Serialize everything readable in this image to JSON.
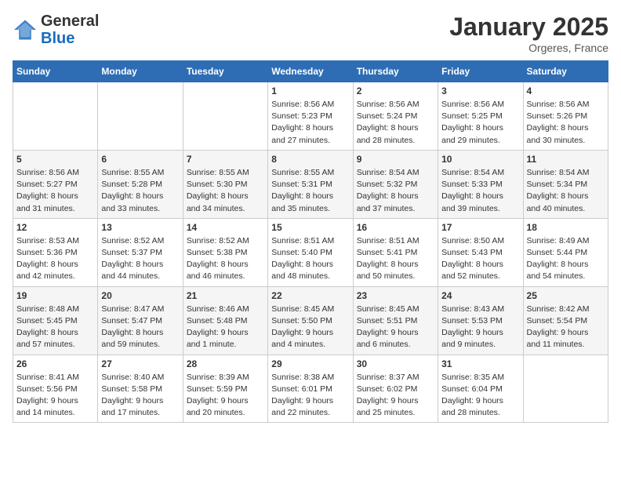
{
  "header": {
    "logo_general": "General",
    "logo_blue": "Blue",
    "month": "January 2025",
    "location": "Orgeres, France"
  },
  "weekdays": [
    "Sunday",
    "Monday",
    "Tuesday",
    "Wednesday",
    "Thursday",
    "Friday",
    "Saturday"
  ],
  "weeks": [
    [
      {
        "day": "",
        "content": ""
      },
      {
        "day": "",
        "content": ""
      },
      {
        "day": "",
        "content": ""
      },
      {
        "day": "1",
        "content": "Sunrise: 8:56 AM\nSunset: 5:23 PM\nDaylight: 8 hours\nand 27 minutes."
      },
      {
        "day": "2",
        "content": "Sunrise: 8:56 AM\nSunset: 5:24 PM\nDaylight: 8 hours\nand 28 minutes."
      },
      {
        "day": "3",
        "content": "Sunrise: 8:56 AM\nSunset: 5:25 PM\nDaylight: 8 hours\nand 29 minutes."
      },
      {
        "day": "4",
        "content": "Sunrise: 8:56 AM\nSunset: 5:26 PM\nDaylight: 8 hours\nand 30 minutes."
      }
    ],
    [
      {
        "day": "5",
        "content": "Sunrise: 8:56 AM\nSunset: 5:27 PM\nDaylight: 8 hours\nand 31 minutes."
      },
      {
        "day": "6",
        "content": "Sunrise: 8:55 AM\nSunset: 5:28 PM\nDaylight: 8 hours\nand 33 minutes."
      },
      {
        "day": "7",
        "content": "Sunrise: 8:55 AM\nSunset: 5:30 PM\nDaylight: 8 hours\nand 34 minutes."
      },
      {
        "day": "8",
        "content": "Sunrise: 8:55 AM\nSunset: 5:31 PM\nDaylight: 8 hours\nand 35 minutes."
      },
      {
        "day": "9",
        "content": "Sunrise: 8:54 AM\nSunset: 5:32 PM\nDaylight: 8 hours\nand 37 minutes."
      },
      {
        "day": "10",
        "content": "Sunrise: 8:54 AM\nSunset: 5:33 PM\nDaylight: 8 hours\nand 39 minutes."
      },
      {
        "day": "11",
        "content": "Sunrise: 8:54 AM\nSunset: 5:34 PM\nDaylight: 8 hours\nand 40 minutes."
      }
    ],
    [
      {
        "day": "12",
        "content": "Sunrise: 8:53 AM\nSunset: 5:36 PM\nDaylight: 8 hours\nand 42 minutes."
      },
      {
        "day": "13",
        "content": "Sunrise: 8:52 AM\nSunset: 5:37 PM\nDaylight: 8 hours\nand 44 minutes."
      },
      {
        "day": "14",
        "content": "Sunrise: 8:52 AM\nSunset: 5:38 PM\nDaylight: 8 hours\nand 46 minutes."
      },
      {
        "day": "15",
        "content": "Sunrise: 8:51 AM\nSunset: 5:40 PM\nDaylight: 8 hours\nand 48 minutes."
      },
      {
        "day": "16",
        "content": "Sunrise: 8:51 AM\nSunset: 5:41 PM\nDaylight: 8 hours\nand 50 minutes."
      },
      {
        "day": "17",
        "content": "Sunrise: 8:50 AM\nSunset: 5:43 PM\nDaylight: 8 hours\nand 52 minutes."
      },
      {
        "day": "18",
        "content": "Sunrise: 8:49 AM\nSunset: 5:44 PM\nDaylight: 8 hours\nand 54 minutes."
      }
    ],
    [
      {
        "day": "19",
        "content": "Sunrise: 8:48 AM\nSunset: 5:45 PM\nDaylight: 8 hours\nand 57 minutes."
      },
      {
        "day": "20",
        "content": "Sunrise: 8:47 AM\nSunset: 5:47 PM\nDaylight: 8 hours\nand 59 minutes."
      },
      {
        "day": "21",
        "content": "Sunrise: 8:46 AM\nSunset: 5:48 PM\nDaylight: 9 hours\nand 1 minute."
      },
      {
        "day": "22",
        "content": "Sunrise: 8:45 AM\nSunset: 5:50 PM\nDaylight: 9 hours\nand 4 minutes."
      },
      {
        "day": "23",
        "content": "Sunrise: 8:45 AM\nSunset: 5:51 PM\nDaylight: 9 hours\nand 6 minutes."
      },
      {
        "day": "24",
        "content": "Sunrise: 8:43 AM\nSunset: 5:53 PM\nDaylight: 9 hours\nand 9 minutes."
      },
      {
        "day": "25",
        "content": "Sunrise: 8:42 AM\nSunset: 5:54 PM\nDaylight: 9 hours\nand 11 minutes."
      }
    ],
    [
      {
        "day": "26",
        "content": "Sunrise: 8:41 AM\nSunset: 5:56 PM\nDaylight: 9 hours\nand 14 minutes."
      },
      {
        "day": "27",
        "content": "Sunrise: 8:40 AM\nSunset: 5:58 PM\nDaylight: 9 hours\nand 17 minutes."
      },
      {
        "day": "28",
        "content": "Sunrise: 8:39 AM\nSunset: 5:59 PM\nDaylight: 9 hours\nand 20 minutes."
      },
      {
        "day": "29",
        "content": "Sunrise: 8:38 AM\nSunset: 6:01 PM\nDaylight: 9 hours\nand 22 minutes."
      },
      {
        "day": "30",
        "content": "Sunrise: 8:37 AM\nSunset: 6:02 PM\nDaylight: 9 hours\nand 25 minutes."
      },
      {
        "day": "31",
        "content": "Sunrise: 8:35 AM\nSunset: 6:04 PM\nDaylight: 9 hours\nand 28 minutes."
      },
      {
        "day": "",
        "content": ""
      }
    ]
  ]
}
